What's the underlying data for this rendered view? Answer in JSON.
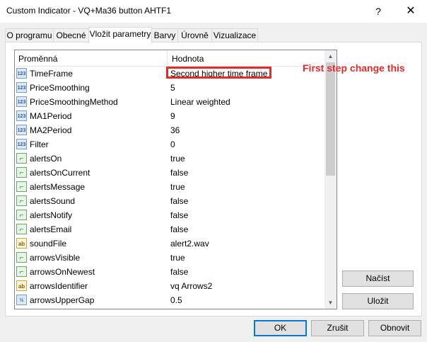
{
  "window": {
    "title": "Custom Indicator - VQ+Ma36 button AHTF1",
    "help_label": "?",
    "close_label": "✕"
  },
  "tabs": [
    {
      "label": "O programu"
    },
    {
      "label": "Obecné"
    },
    {
      "label": "Vložit parametry"
    },
    {
      "label": "Barvy"
    },
    {
      "label": "Úrovně"
    },
    {
      "label": "Vizualizace"
    }
  ],
  "active_tab": "Vložit parametry",
  "grid": {
    "col_name": "Proměnná",
    "col_value": "Hodnota",
    "rows": [
      {
        "icon": "123",
        "name": "TimeFrame",
        "value": "Second higher time frame"
      },
      {
        "icon": "123",
        "name": "PriceSmoothing",
        "value": "5"
      },
      {
        "icon": "123",
        "name": "PriceSmoothingMethod",
        "value": "Linear weighted"
      },
      {
        "icon": "123",
        "name": "MA1Period",
        "value": "9"
      },
      {
        "icon": "123",
        "name": "MA2Period",
        "value": "36"
      },
      {
        "icon": "123",
        "name": "Filter",
        "value": "0"
      },
      {
        "icon": "bool",
        "name": "alertsOn",
        "value": "true"
      },
      {
        "icon": "bool",
        "name": "alertsOnCurrent",
        "value": "false"
      },
      {
        "icon": "bool",
        "name": "alertsMessage",
        "value": "true"
      },
      {
        "icon": "bool",
        "name": "alertsSound",
        "value": "false"
      },
      {
        "icon": "bool",
        "name": "alertsNotify",
        "value": "false"
      },
      {
        "icon": "bool",
        "name": "alertsEmail",
        "value": "false"
      },
      {
        "icon": "ab",
        "name": "soundFile",
        "value": "alert2.wav"
      },
      {
        "icon": "bool",
        "name": "arrowsVisible",
        "value": "true"
      },
      {
        "icon": "bool",
        "name": "arrowsOnNewest",
        "value": "false"
      },
      {
        "icon": "ab",
        "name": "arrowsIdentifier",
        "value": "vq Arrows2"
      },
      {
        "icon": "v2",
        "name": "arrowsUpperGap",
        "value": "0.5"
      }
    ]
  },
  "annotation": {
    "text": "First step change this",
    "color": "#e52a2a"
  },
  "side_buttons": {
    "load": "Načíst",
    "save": "Uložit"
  },
  "footer_buttons": {
    "ok": "OK",
    "reset": "Zrušit",
    "renew": "Obnovit"
  }
}
